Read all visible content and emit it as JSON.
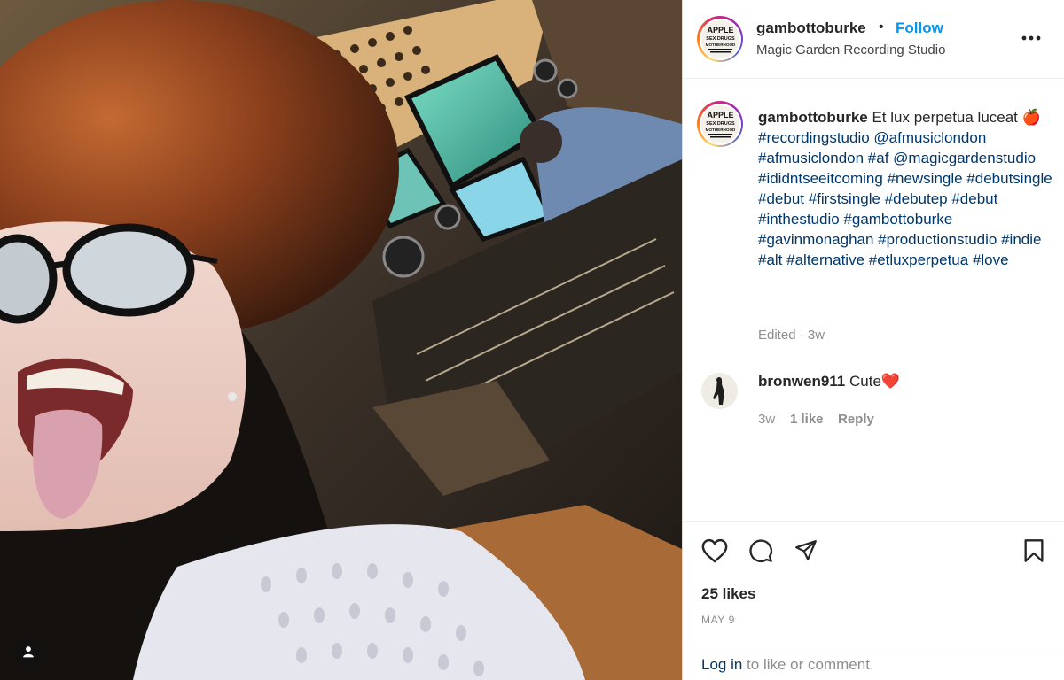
{
  "post": {
    "username": "gambottoburke",
    "separator": "•",
    "follow_label": "Follow",
    "location": "Magic Garden Recording Studio",
    "more_icon": "more-horizontal-icon"
  },
  "caption": {
    "username": "gambottoburke",
    "text": "Et lux perpetua luceat",
    "emoji": "🍎",
    "hashtags": "#recordingstudio @afmusiclondon #afmusiclondon #af @magicgardenstudio #ididntseeitcoming #newsingle #debutsingle #debut #firstsingle #debutep #debut #inthestudio #gambottoburke #gavinmonaghan #productionstudio #indie #alt #alternative #etluxperpetua #love",
    "meta": "Edited · 3w"
  },
  "avatar_logo": {
    "line1": "APPLE",
    "line2": "SEX DRUGS",
    "line3": "MOTHERHOOD"
  },
  "comment": {
    "username": "bronwen911",
    "text": "Cute❤️",
    "time": "3w",
    "likes": "1 like",
    "reply_label": "Reply"
  },
  "actions": {
    "likes": "25 likes",
    "date": "MAY 9",
    "login_link": "Log in",
    "login_suffix": " to like or comment."
  },
  "colors": {
    "follow": "#0095f6",
    "hashtag": "#00376b",
    "muted": "#8e8e8e"
  }
}
